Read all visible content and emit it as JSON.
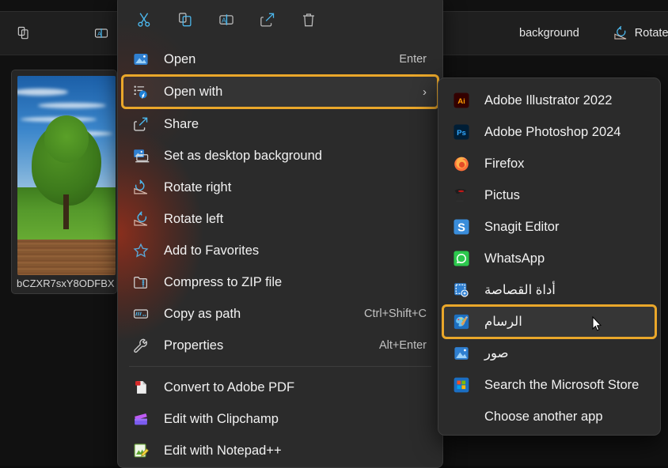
{
  "background": {
    "toolbar_items": [
      {
        "label": "",
        "icon": "copy-icon"
      },
      {
        "label": "",
        "icon": "rename-icon"
      },
      {
        "label": "",
        "icon": "share-icon"
      },
      {
        "label": "background",
        "icon": "none"
      },
      {
        "label": "Rotate left",
        "icon": "rotate-left-icon"
      },
      {
        "label": "",
        "icon": "rotate-right-icon"
      }
    ],
    "thumbnail": {
      "filename": "bCZXR7sxY8ODFBX",
      "alt": "tree-in-field-photo"
    }
  },
  "context_menu": {
    "header_actions": [
      {
        "name": "cut",
        "icon": "scissors-icon"
      },
      {
        "name": "copy",
        "icon": "copy-icon"
      },
      {
        "name": "rename",
        "icon": "rename-icon"
      },
      {
        "name": "share",
        "icon": "share-icon"
      },
      {
        "name": "delete",
        "icon": "trash-icon"
      }
    ],
    "items": [
      {
        "label": "Open",
        "accel": "Enter",
        "icon": "photos-icon",
        "highlighted": false,
        "submenu": false
      },
      {
        "label": "Open with",
        "accel": "",
        "icon": "open-with-icon",
        "highlighted": true,
        "submenu": true
      },
      {
        "label": "Share",
        "accel": "",
        "icon": "share-icon",
        "highlighted": false,
        "submenu": false
      },
      {
        "label": "Set as desktop background",
        "accel": "",
        "icon": "desktop-background-icon",
        "highlighted": false,
        "submenu": false
      },
      {
        "label": "Rotate right",
        "accel": "",
        "icon": "rotate-right-icon",
        "highlighted": false,
        "submenu": false
      },
      {
        "label": "Rotate left",
        "accel": "",
        "icon": "rotate-left-icon",
        "highlighted": false,
        "submenu": false
      },
      {
        "label": "Add to Favorites",
        "accel": "",
        "icon": "star-icon",
        "highlighted": false,
        "submenu": false
      },
      {
        "label": "Compress to ZIP file",
        "accel": "",
        "icon": "zip-folder-icon",
        "highlighted": false,
        "submenu": false
      },
      {
        "label": "Copy as path",
        "accel": "Ctrl+Shift+C",
        "icon": "copy-path-icon",
        "highlighted": false,
        "submenu": false
      },
      {
        "label": "Properties",
        "accel": "Alt+Enter",
        "icon": "wrench-icon",
        "highlighted": false,
        "submenu": false
      }
    ],
    "items_after_separator": [
      {
        "label": "Convert to Adobe PDF",
        "icon": "adobe-pdf-icon"
      },
      {
        "label": "Edit with Clipchamp",
        "icon": "clipchamp-icon"
      },
      {
        "label": "Edit with Notepad++",
        "icon": "notepadpp-icon"
      }
    ],
    "chevron_glyph": "›"
  },
  "submenu": {
    "items": [
      {
        "label": "Adobe Illustrator 2022",
        "icon": "adobe-illustrator-icon",
        "rtl": false,
        "hovered": false
      },
      {
        "label": "Adobe Photoshop 2024",
        "icon": "adobe-photoshop-icon",
        "rtl": false,
        "hovered": false
      },
      {
        "label": "Firefox",
        "icon": "firefox-icon",
        "rtl": false,
        "hovered": false
      },
      {
        "label": "Pictus",
        "icon": "pictus-icon",
        "rtl": false,
        "hovered": false
      },
      {
        "label": "Snagit Editor",
        "icon": "snagit-icon",
        "rtl": false,
        "hovered": false
      },
      {
        "label": "WhatsApp",
        "icon": "whatsapp-icon",
        "rtl": false,
        "hovered": false
      },
      {
        "label": "أداة القصاصة",
        "icon": "snipping-tool-icon",
        "rtl": true,
        "hovered": false
      },
      {
        "label": "الرسام",
        "icon": "paint-icon",
        "rtl": true,
        "hovered": true
      },
      {
        "label": "صور",
        "icon": "photos-icon",
        "rtl": true,
        "hovered": false
      },
      {
        "label": "Search the Microsoft Store",
        "icon": "microsoft-store-icon",
        "rtl": false,
        "hovered": false
      },
      {
        "label": "Choose another app",
        "icon": "none",
        "rtl": false,
        "hovered": false
      }
    ]
  },
  "colors": {
    "menu_bg": "#2b2b2b",
    "highlight": "#eaa72a",
    "accent_blue": "#4cb8ee",
    "text": "#f2f2f2",
    "glow_red": "#c43014"
  }
}
